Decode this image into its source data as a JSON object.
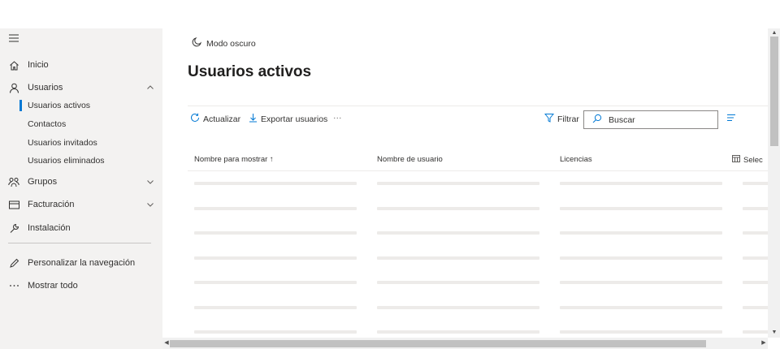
{
  "sidebar": {
    "items": [
      {
        "label": "Inicio",
        "icon": "home-icon"
      },
      {
        "label": "Usuarios",
        "icon": "person-icon"
      },
      {
        "label": "Grupos",
        "icon": "groups-icon"
      },
      {
        "label": "Facturación",
        "icon": "billing-icon"
      },
      {
        "label": "Instalación",
        "icon": "wrench-icon"
      },
      {
        "label": "Personalizar la navegación",
        "icon": "pencil-icon"
      },
      {
        "label": "Mostrar todo",
        "icon": "more-icon"
      }
    ],
    "users_submenu": [
      {
        "label": "Usuarios activos",
        "active": true
      },
      {
        "label": "Contactos"
      },
      {
        "label": "Usuarios invitados"
      },
      {
        "label": "Usuarios eliminados"
      }
    ]
  },
  "main": {
    "dark_mode_label": "Modo oscuro",
    "title": "Usuarios activos",
    "commands": {
      "refresh": "Actualizar",
      "export": "Exportar usuarios",
      "more": "···",
      "filter": "Filtrar"
    },
    "search_placeholder": "Buscar",
    "columns": [
      "Nombre para mostrar ↑",
      "Nombre de usuario",
      "Licencias",
      "Selec"
    ]
  },
  "colors": {
    "accent": "#0078d4",
    "sidebar_bg": "#f3f2f1",
    "shimmer": "#edebe9"
  }
}
